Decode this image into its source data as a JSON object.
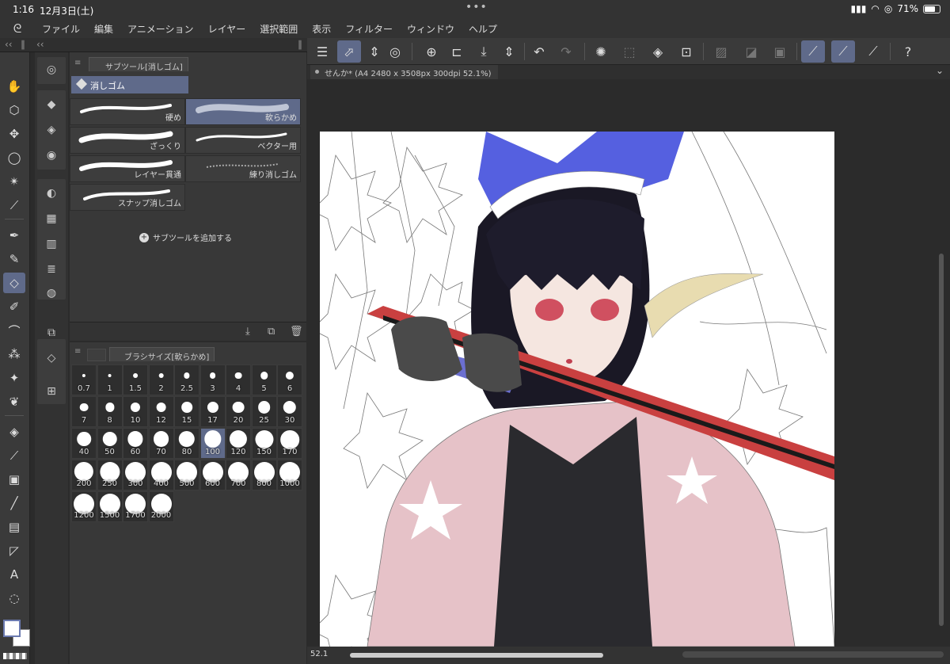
{
  "status_bar": {
    "time": "1:16",
    "date": "12月3日(土)",
    "battery": "71%",
    "battery_level": 0.71
  },
  "menu": [
    "ファイル",
    "編集",
    "アニメーション",
    "レイヤー",
    "選択範囲",
    "表示",
    "フィルター",
    "ウィンドウ",
    "ヘルプ"
  ],
  "subtool_panel": {
    "title": "サブツール[消しゴム]",
    "group": "消しゴム",
    "brushes": [
      "硬め",
      "軟らかめ",
      "ざっくり",
      "ベクター用",
      "レイヤー貫通",
      "練り消しゴム",
      "スナップ消しゴム"
    ],
    "selected_brush": "軟らかめ",
    "add_label": "サブツールを追加する"
  },
  "brushsize_panel": {
    "title": "ブラシサイズ[軟らかめ]",
    "sizes": [
      "0.7",
      "1",
      "1.5",
      "2",
      "2.5",
      "3",
      "4",
      "5",
      "6",
      "7",
      "8",
      "10",
      "12",
      "15",
      "17",
      "20",
      "25",
      "30",
      "40",
      "50",
      "60",
      "70",
      "80",
      "100",
      "120",
      "150",
      "170",
      "200",
      "250",
      "300",
      "400",
      "500",
      "600",
      "700",
      "800",
      "1000",
      "1200",
      "1500",
      "1700",
      "2000"
    ],
    "selected": "100"
  },
  "document": {
    "tab_title": "せんか* (A4 2480 x 3508px 300dpi 52.1%)",
    "zoom": "52.1"
  },
  "colors": {
    "accent": "#5f6a8a",
    "panel": "#383838",
    "background": "#2b2b2b"
  },
  "icons": [
    "hand-icon",
    "object-select-icon",
    "move-icon",
    "lasso-icon",
    "magic-wand-icon",
    "eyedropper-icon",
    "pen-icon",
    "pencil-icon",
    "eraser-icon",
    "brush-icon",
    "curve-icon",
    "airbrush-icon",
    "decoration-icon",
    "blend-icon",
    "fill-icon",
    "gradient-icon",
    "figure-icon",
    "frame-icon",
    "ruler-icon",
    "text-icon",
    "balloon-icon"
  ]
}
